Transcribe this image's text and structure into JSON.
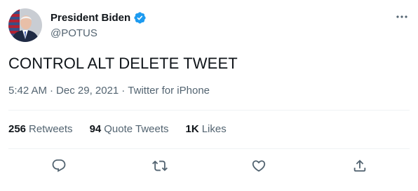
{
  "author": {
    "display_name": "President Biden",
    "handle": "@POTUS",
    "verified": true
  },
  "tweet": {
    "text": "CONTROL ALT DELETE TWEET",
    "time": "5:42 AM",
    "date": "Dec 29, 2021",
    "source": "Twitter for iPhone",
    "separator": "·"
  },
  "stats": {
    "retweets": {
      "count": "256",
      "label": "Retweets"
    },
    "quote_tweets": {
      "count": "94",
      "label": "Quote Tweets"
    },
    "likes": {
      "count": "1K",
      "label": "Likes"
    }
  },
  "colors": {
    "accent": "#1d9bf0",
    "secondary_text": "#536471",
    "primary_text": "#0f1419",
    "divider": "#eff3f4"
  },
  "icons": {
    "more": "more-horizontal-icon",
    "verified": "verified-badge-icon",
    "reply": "reply-icon",
    "retweet": "retweet-icon",
    "like": "heart-icon",
    "share": "share-icon"
  }
}
